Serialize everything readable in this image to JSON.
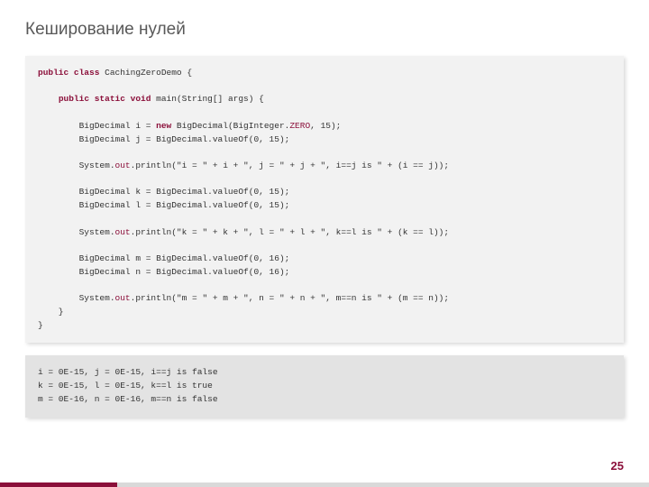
{
  "title": "Кеширование нулей",
  "code_tokens": [
    {
      "t": "kw",
      "v": "public class"
    },
    {
      "t": "p",
      "v": " CachingZeroDemo {\n\n    "
    },
    {
      "t": "kw",
      "v": "public static void"
    },
    {
      "t": "p",
      "v": " main(String[] args) {\n\n        BigDecimal i = "
    },
    {
      "t": "kw",
      "v": "new"
    },
    {
      "t": "p",
      "v": " BigDecimal(BigInteger."
    },
    {
      "t": "field",
      "v": "ZERO"
    },
    {
      "t": "p",
      "v": ", 15);\n        BigDecimal j = BigDecimal.valueOf(0, 15);\n\n        System."
    },
    {
      "t": "field",
      "v": "out"
    },
    {
      "t": "p",
      "v": ".println(\"i = \" + i + \", j = \" + j + \", i==j is \" + (i == j));\n\n        BigDecimal k = BigDecimal.valueOf(0, 15);\n        BigDecimal l = BigDecimal.valueOf(0, 15);\n\n        System."
    },
    {
      "t": "field",
      "v": "out"
    },
    {
      "t": "p",
      "v": ".println(\"k = \" + k + \", l = \" + l + \", k==l is \" + (k == l));\n\n        BigDecimal m = BigDecimal.valueOf(0, 16);\n        BigDecimal n = BigDecimal.valueOf(0, 16);\n\n        System."
    },
    {
      "t": "field",
      "v": "out"
    },
    {
      "t": "p",
      "v": ".println(\"m = \" + m + \", n = \" + n + \", m==n is \" + (m == n));\n    }\n}"
    }
  ],
  "output": "i = 0E-15, j = 0E-15, i==j is false\nk = 0E-15, l = 0E-15, k==l is true\nm = 0E-16, n = 0E-16, m==n is false",
  "page_number": "25",
  "colors": {
    "accent": "#8b0f3a"
  }
}
